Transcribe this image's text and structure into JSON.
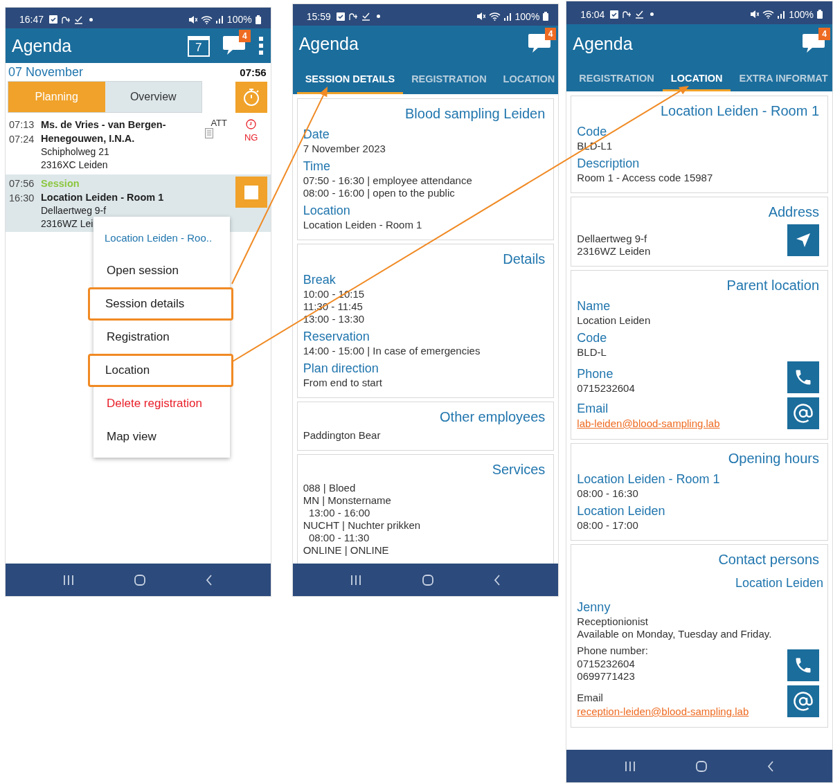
{
  "agenda_screen": {
    "status_bar": {
      "time": "16:47",
      "battery": "100%"
    },
    "app_bar": {
      "title": "Agenda",
      "calendar_day": "7",
      "badge": "4"
    },
    "date": "07 November",
    "current_time": "07:56",
    "tabs": [
      {
        "label": "Planning",
        "selected": true
      },
      {
        "label": "Overview",
        "selected": false
      }
    ],
    "items": [
      {
        "kind": "appointment",
        "selected": false,
        "start": "07:13",
        "end": "07:24",
        "title": "Ms. de Vries - van Bergen-Henegouwen, I.N.A.",
        "lines": [
          "Schipholweg 21",
          "2316XC Leiden"
        ],
        "tag": "ATT",
        "status": "NG"
      },
      {
        "kind": "session",
        "selected": true,
        "start": "07:56",
        "end": "16:30",
        "label": "Session",
        "title": "Location Leiden - Room 1",
        "lines": [
          "Dellaertweg 9-f",
          "2316WZ Lei"
        ]
      }
    ],
    "menu": {
      "header": "Location Leiden - Roo..",
      "items": [
        {
          "label": "Open session",
          "kind": "normal",
          "highlighted": false
        },
        {
          "label": "Session details",
          "kind": "normal",
          "highlighted": true
        },
        {
          "label": "Registration",
          "kind": "normal",
          "highlighted": false
        },
        {
          "label": "Location",
          "kind": "normal",
          "highlighted": true
        },
        {
          "label": "Delete registration",
          "kind": "danger",
          "highlighted": false
        },
        {
          "label": "Map view",
          "kind": "normal",
          "highlighted": false
        }
      ]
    }
  },
  "session_details_screen": {
    "status_bar": {
      "time": "15:59",
      "battery": "100%"
    },
    "app_bar": {
      "title": "Agenda",
      "badge": "4"
    },
    "tabs": [
      {
        "label": "SESSION DETAILS",
        "selected": true
      },
      {
        "label": "REGISTRATION",
        "selected": false
      },
      {
        "label": "LOCATION",
        "selected": false
      }
    ],
    "cards": [
      {
        "title": "Blood sampling Leiden",
        "fields": [
          {
            "label": "Date",
            "lines": [
              "7 November 2023"
            ]
          },
          {
            "label": "Time",
            "lines": [
              "07:50 - 16:30 | employee attendance",
              "08:00 - 16:00 | open to the public"
            ]
          },
          {
            "label": "Location",
            "lines": [
              "Location Leiden - Room 1"
            ]
          }
        ]
      },
      {
        "title": "Details",
        "fields": [
          {
            "label": "Break",
            "lines": [
              "10:00 - 10:15",
              "11:30 - 11:45",
              "13:00 - 13:30"
            ]
          },
          {
            "label": "Reservation",
            "lines": [
              "14:00 - 15:00 | In case of emergencies"
            ]
          },
          {
            "label": "Plan direction",
            "lines": [
              "From end to start"
            ]
          }
        ]
      },
      {
        "title": "Other employees",
        "fields": [
          {
            "lines": [
              "Paddington Bear"
            ]
          }
        ]
      },
      {
        "title": "Services",
        "fields": [
          {
            "lines": [
              "088 | Bloed",
              "MN | Monstername",
              "  13:00 - 16:00",
              "NUCHT | Nuchter prikken",
              "  08:00 - 11:30",
              "ONLINE | ONLINE"
            ]
          }
        ]
      }
    ]
  },
  "location_screen": {
    "status_bar": {
      "time": "16:04",
      "battery": "100%"
    },
    "app_bar": {
      "title": "Agenda",
      "badge": "4"
    },
    "tabs": [
      {
        "label": "REGISTRATION",
        "selected": false
      },
      {
        "label": "LOCATION",
        "selected": true
      },
      {
        "label": "EXTRA INFORMAT",
        "selected": false
      }
    ],
    "cards": [
      {
        "title": "Location Leiden - Room 1",
        "fields": [
          {
            "label": "Code",
            "lines": [
              "BLD-L1"
            ]
          },
          {
            "label": "Description",
            "lines": [
              "Room 1 - Access code 15987"
            ]
          }
        ]
      },
      {
        "title": "Address",
        "fields": [
          {
            "lines": [
              "Dellaertweg 9-f",
              "2316WZ Leiden"
            ],
            "action": {
              "kind": "navigate"
            }
          }
        ]
      },
      {
        "title": "Parent location",
        "fields": [
          {
            "label": "Name",
            "lines": [
              "Location Leiden"
            ]
          },
          {
            "label": "Code",
            "lines": [
              "BLD-L"
            ]
          },
          {
            "label": "Phone",
            "lines": [
              "0715232604"
            ],
            "action": {
              "kind": "call"
            }
          },
          {
            "label": "Email",
            "link": "lab-leiden@blood-sampling.lab",
            "action": {
              "kind": "email"
            }
          }
        ]
      },
      {
        "title": "Opening hours",
        "fields": [
          {
            "label": "Location Leiden - Room 1",
            "lines": [
              "08:00 - 16:30"
            ]
          },
          {
            "label": "Location Leiden",
            "lines": [
              "08:00 - 17:00"
            ]
          }
        ]
      },
      {
        "title": "Contact persons",
        "subtitle": "Location Leiden",
        "fields": [
          {
            "kind": "person",
            "label": "Jenny",
            "lines": [
              "Receptionionist",
              "Available on Monday, Tuesday and Friday."
            ]
          },
          {
            "kind": "note",
            "label": "Phone number:",
            "lines": [
              "0715232604",
              "0699771423"
            ],
            "action": {
              "kind": "call"
            }
          },
          {
            "kind": "note",
            "label": "Email",
            "link": "reception-leiden@blood-sampling.lab",
            "action": {
              "kind": "email"
            }
          }
        ]
      }
    ]
  }
}
